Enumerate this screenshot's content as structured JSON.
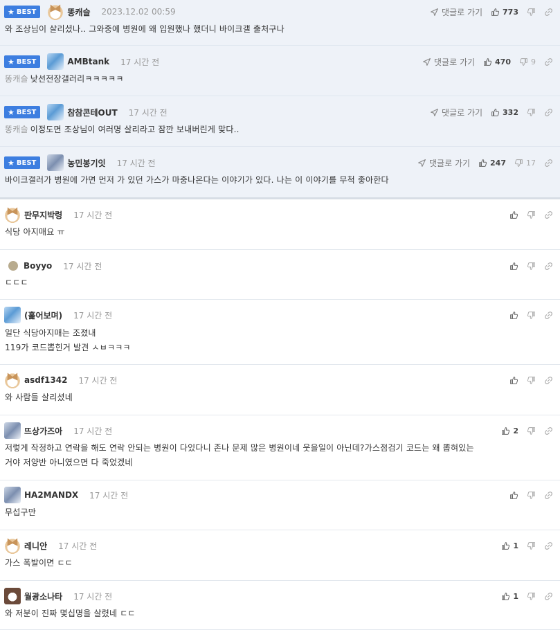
{
  "labels": {
    "best": "BEST",
    "reply_link": "댓글로 가기"
  },
  "comments": [
    {
      "best": true,
      "nick": "똥캐슬",
      "time": "2023.12.02 00:59",
      "likes": "773",
      "dislikes": "",
      "mention": "",
      "lines": [
        "와 조상님이 살리셨나.. 그와중에 병원에 왜 입원했나 했더니 바이크갤 출처구나"
      ],
      "avatar": "dog"
    },
    {
      "best": true,
      "nick": "AMBtank",
      "time": "17 시간 전",
      "likes": "470",
      "dislikes": "9",
      "mention": "똥캐슬",
      "lines": [
        "낮선전장갤러리ㅋㅋㅋㅋㅋ"
      ],
      "avatar": "blue"
    },
    {
      "best": true,
      "nick": "참참콘테OUT",
      "time": "17 시간 전",
      "likes": "332",
      "dislikes": "",
      "mention": "똥캐슬",
      "lines": [
        "이정도면 조상님이 여러명 살리라고 잠깐 보내버린게 맞다.."
      ],
      "avatar": "blue"
    },
    {
      "best": true,
      "nick": "농민봉기잇",
      "time": "17 시간 전",
      "likes": "247",
      "dislikes": "17",
      "mention": "",
      "lines": [
        "바이크갤러가 병원에 가면 먼저 가 있던 가스가 마중나온다는 이야기가 있다. 나는 이 이야기를 무척 좋아한다"
      ],
      "avatar": "grey"
    },
    {
      "best": false,
      "nick": "판무지박령",
      "time": "17 시간 전",
      "likes": "",
      "dislikes": "",
      "mention": "",
      "lines": [
        "식당 아지매요 ㅠ"
      ],
      "avatar": "dog"
    },
    {
      "best": false,
      "nick": "Boyyo",
      "time": "17 시간 전",
      "likes": "",
      "dislikes": "",
      "mention": "",
      "lines": [
        "ㄷㄷㄷ"
      ],
      "avatar": "dot"
    },
    {
      "best": false,
      "nick": "(훑어보며)",
      "time": "17 시간 전",
      "likes": "",
      "dislikes": "",
      "mention": "",
      "lines": [
        "일단 식당아지매는 조졌내",
        "119가 코드뽑힌거 발견 ㅅㅂㅋㅋㅋ"
      ],
      "avatar": "blue"
    },
    {
      "best": false,
      "nick": "asdf1342",
      "time": "17 시간 전",
      "likes": "",
      "dislikes": "",
      "mention": "",
      "lines": [
        "와 사람들 살리셨네"
      ],
      "avatar": "dog"
    },
    {
      "best": false,
      "nick": "뜨상가즈아",
      "time": "17 시간 전",
      "likes": "2",
      "dislikes": "",
      "mention": "",
      "lines": [
        "저렇게 작정하고 연락을 해도 연락 안되는 병원이 다있다니 존나 문제 많은 병원이네 웃을일이 아닌데?가스점검기 코드는 왜 뽑혀있는",
        "거야 저양반 아니였으면 다 죽었겠네"
      ],
      "avatar": "grey"
    },
    {
      "best": false,
      "nick": "HA2MANDX",
      "time": "17 시간 전",
      "likes": "",
      "dislikes": "",
      "mention": "",
      "lines": [
        "무섭구만"
      ],
      "avatar": "grey"
    },
    {
      "best": false,
      "nick": "레니안",
      "time": "17 시간 전",
      "likes": "1",
      "dislikes": "",
      "mention": "",
      "lines": [
        "가스 폭발이면 ㄷㄷ"
      ],
      "avatar": "dog"
    },
    {
      "best": false,
      "nick": "월광소나타",
      "time": "17 시간 전",
      "likes": "1",
      "dislikes": "",
      "mention": "",
      "lines": [
        "와 저분이 진짜 몇십명을 살렸네 ㄷㄷ"
      ],
      "avatar": "dark"
    }
  ]
}
